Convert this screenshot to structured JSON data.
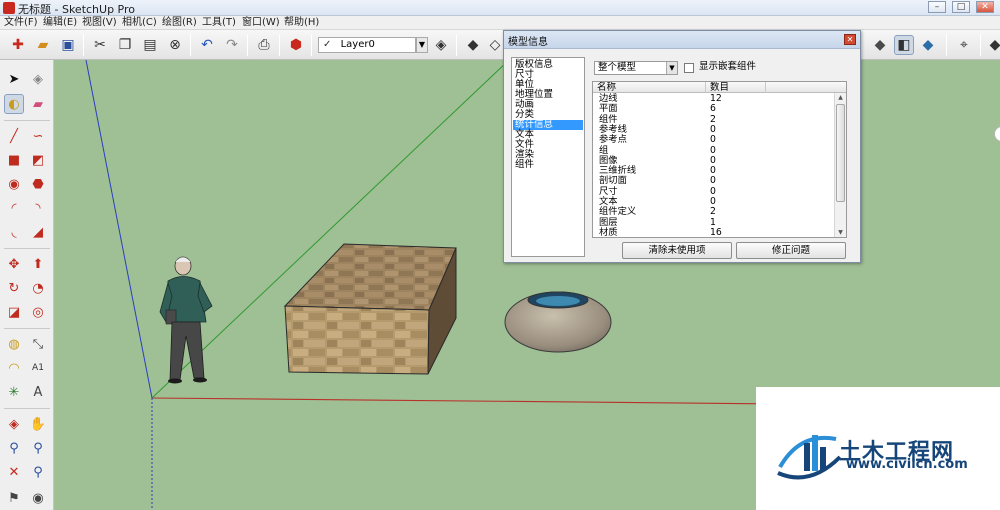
{
  "window": {
    "title": "无标题 - SketchUp Pro",
    "minimize": "–",
    "maximize": "□",
    "close": "✕"
  },
  "menu": [
    "文件(F)",
    "编辑(E)",
    "视图(V)",
    "相机(C)",
    "绘图(R)",
    "工具(T)",
    "窗口(W)",
    "帮助(H)"
  ],
  "toolbar": {
    "layer_check": "✓",
    "layer_name": "Layer0",
    "layer_dropdown": "▼"
  },
  "dialog": {
    "title": "模型信息",
    "close": "✕",
    "nav": [
      "版权信息",
      "尺寸",
      "单位",
      "地理位置",
      "动画",
      "分类",
      "统计信息",
      "文本",
      "文件",
      "渲染",
      "组件"
    ],
    "nav_selected": "统计信息",
    "scope": "整个模型",
    "scope_arrow": "▼",
    "show_nested_label": "显示嵌套组件",
    "show_nested_checked": false,
    "columns": [
      "名称",
      "数目"
    ],
    "rows": [
      {
        "name": "边线",
        "count": "12"
      },
      {
        "name": "平面",
        "count": "6"
      },
      {
        "name": "组件",
        "count": "2"
      },
      {
        "name": "参考线",
        "count": "0"
      },
      {
        "name": "参考点",
        "count": "0"
      },
      {
        "name": "组",
        "count": "0"
      },
      {
        "name": "图像",
        "count": "0"
      },
      {
        "name": "三维折线",
        "count": "0"
      },
      {
        "name": "剖切面",
        "count": "0"
      },
      {
        "name": "尺寸",
        "count": "0"
      },
      {
        "name": "文本",
        "count": "0"
      },
      {
        "name": "组件定义",
        "count": "2"
      },
      {
        "name": "图层",
        "count": "1"
      },
      {
        "name": "材质",
        "count": "16"
      }
    ],
    "scroll_up": "▲",
    "scroll_down": "▼",
    "purge_button": "清除未使用项",
    "fix_button": "修正问题"
  },
  "watermark": {
    "brand": "土木工程网",
    "url": "www.civilcn.com"
  },
  "colors": {
    "viewport_bg": "#9fbf94",
    "red_axis": "#b8322a",
    "green_axis": "#2f9a2f",
    "blue_axis": "#2b3fbf",
    "selection_blue": "#3399ff",
    "brand_blue": "#16457a"
  }
}
